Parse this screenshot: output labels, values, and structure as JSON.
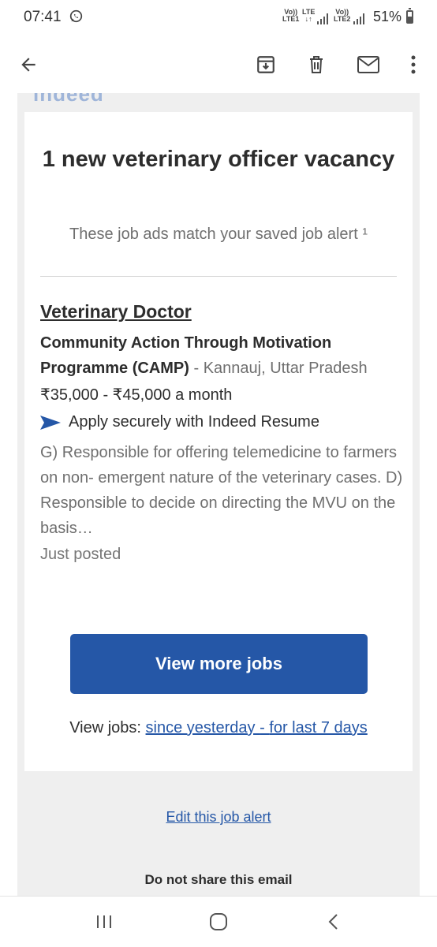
{
  "status_bar": {
    "time": "07:41",
    "sim1_top": "Vo))",
    "sim1_bottom": "LTE1",
    "lte_label": "LTE",
    "sim2_top": "Vo))",
    "sim2_bottom": "LTE2",
    "battery": "51%"
  },
  "app_bar": {
    "icons": [
      "back-arrow-icon",
      "archive-icon",
      "delete-icon",
      "mail-icon",
      "more-vert-icon"
    ]
  },
  "email": {
    "logo_text": "indeed",
    "headline": "1 new veterinary officer vacancy",
    "subline": "These job ads match your saved job alert ¹",
    "job": {
      "title": "Veterinary Doctor",
      "company": "Community Action Through Motivation Programme (CAMP)",
      "location": " - Kannauj, Uttar Pradesh",
      "salary": "₹35,000 - ₹45,000 a month",
      "apply_text": "Apply securely with Indeed Resume",
      "snippet": "G) Responsible for offering telemedicine to farmers on non- emergent nature of the veterinary cases. D) Responsible to decide on directing the MVU on the basis…",
      "posted": "Just posted"
    },
    "cta_label": "View more jobs",
    "view_jobs_prefix": "View jobs: ",
    "since_yesterday": "since yesterday ",
    "separator": "- ",
    "last_7_days": "for last 7 days",
    "edit_alert": "Edit this job alert",
    "do_not_share": "Do not share this email"
  },
  "colors": {
    "accent": "#2557a7",
    "background": "#efefef",
    "card": "#ffffff"
  }
}
